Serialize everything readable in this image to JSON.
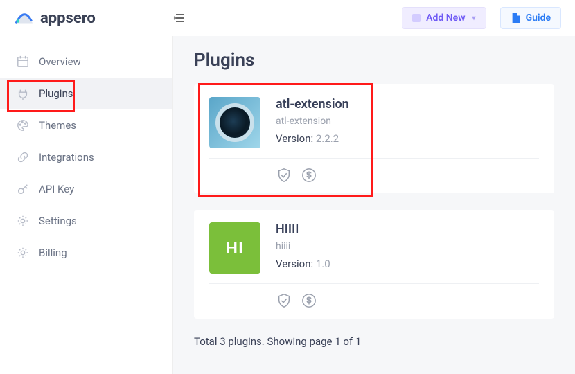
{
  "brand": "appsero",
  "header": {
    "addnew_label": "Add New",
    "guide_label": "Guide"
  },
  "sidebar": {
    "items": [
      {
        "label": "Overview"
      },
      {
        "label": "Plugins"
      },
      {
        "label": "Themes"
      },
      {
        "label": "Integrations"
      },
      {
        "label": "API Key"
      },
      {
        "label": "Settings"
      },
      {
        "label": "Billing"
      }
    ]
  },
  "page": {
    "title": "Plugins",
    "summary": "Total 3 plugins. Showing page 1 of 1"
  },
  "plugins": [
    {
      "name": "atl-extension",
      "slug": "atl-extension",
      "version_label": "Version:",
      "version": "2.2.2",
      "thumb_text": "",
      "thumb_type": "camera"
    },
    {
      "name": "HIIII",
      "slug": "hiiii",
      "version_label": "Version:",
      "version": "1.0",
      "thumb_text": "HI",
      "thumb_type": "hi"
    }
  ]
}
